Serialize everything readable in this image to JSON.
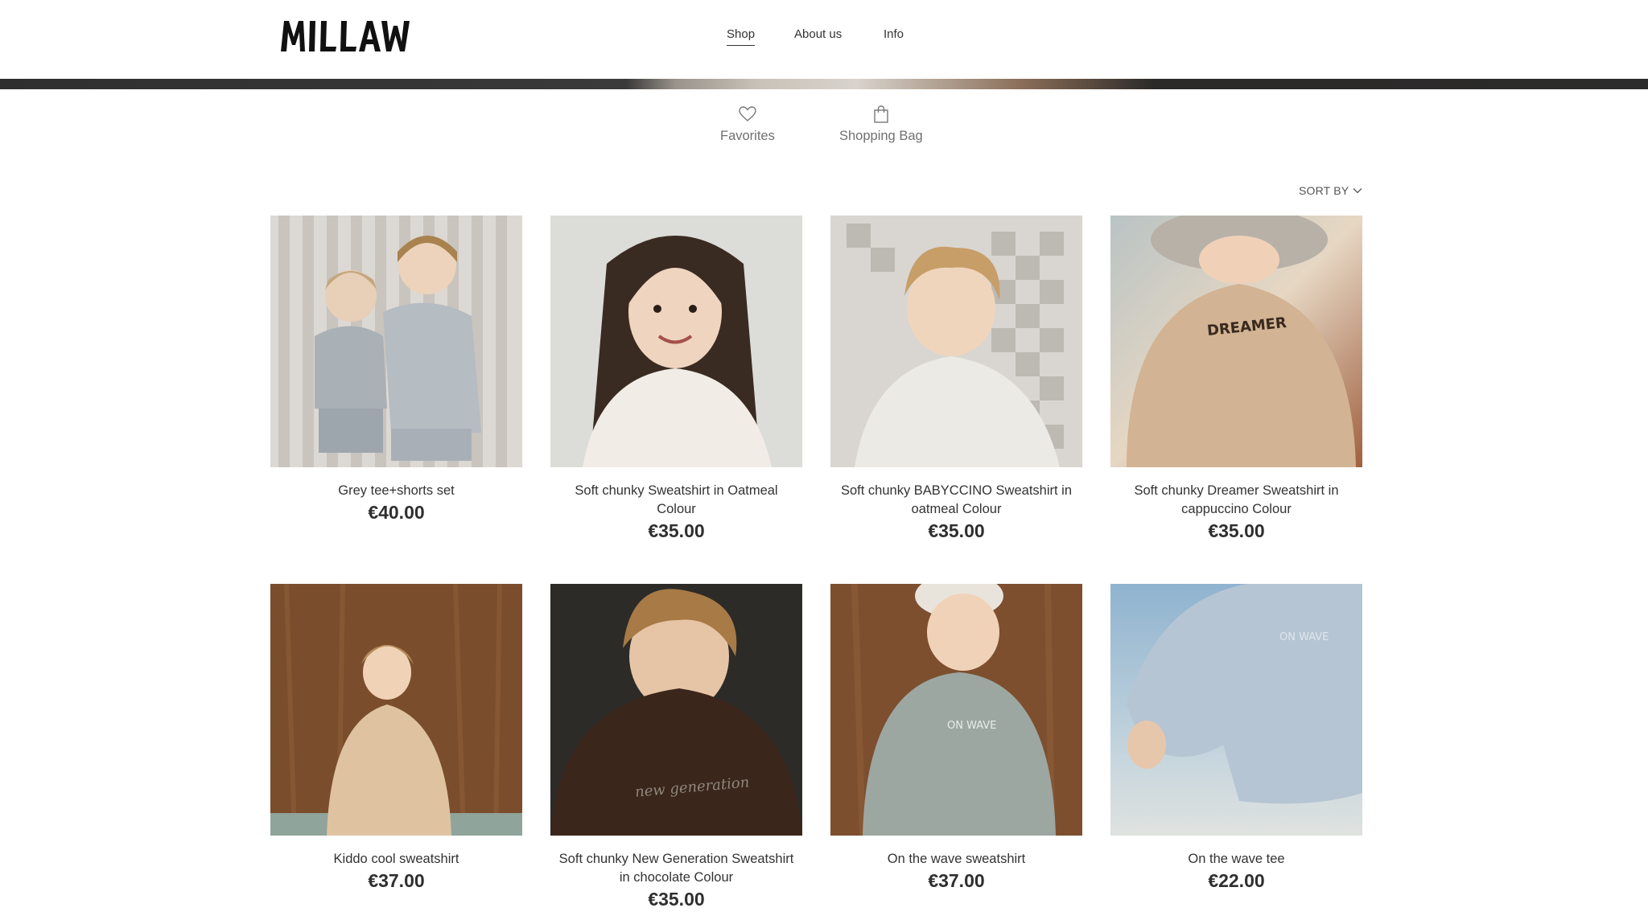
{
  "brand": {
    "logo_text": "MILLAW"
  },
  "nav": {
    "items": [
      {
        "label": "Shop",
        "active": true
      },
      {
        "label": "About us",
        "active": false
      },
      {
        "label": "Info",
        "active": false
      }
    ]
  },
  "quick_links": {
    "favorites": "Favorites",
    "shopping_bag": "Shopping Bag"
  },
  "sort": {
    "label": "SORT BY"
  },
  "products": [
    {
      "title": "Grey tee+shorts set",
      "price": "€40.00",
      "image": "two-kids-grey-set"
    },
    {
      "title": "Soft chunky Sweatshirt in Oatmeal Colour",
      "price": "€35.00",
      "image": "girl-oatmeal-sweatshirt"
    },
    {
      "title": "Soft chunky BABYCCINO Sweatshirt in oatmeal Colour",
      "price": "€35.00",
      "image": "boy-babyccino-sweatshirt"
    },
    {
      "title": "Soft chunky Dreamer Sweatshirt in cappuccino Colour",
      "price": "€35.00",
      "image": "child-dreamer-sweatshirt"
    },
    {
      "title": "Kiddo cool sweatshirt",
      "price": "€37.00",
      "image": "boy-kiddo-sweatshirt"
    },
    {
      "title": "Soft chunky New Generation Sweatshirt in chocolate Colour",
      "price": "€35.00",
      "image": "boy-new-generation-sweatshirt"
    },
    {
      "title": "On the wave sweatshirt",
      "price": "€37.00",
      "image": "boy-on-the-wave-sweatshirt"
    },
    {
      "title": "On the wave tee",
      "price": "€22.00",
      "image": "child-on-the-wave-tee"
    }
  ],
  "colors": {
    "text": "#333333",
    "muted": "#707070",
    "background": "#ffffff"
  }
}
